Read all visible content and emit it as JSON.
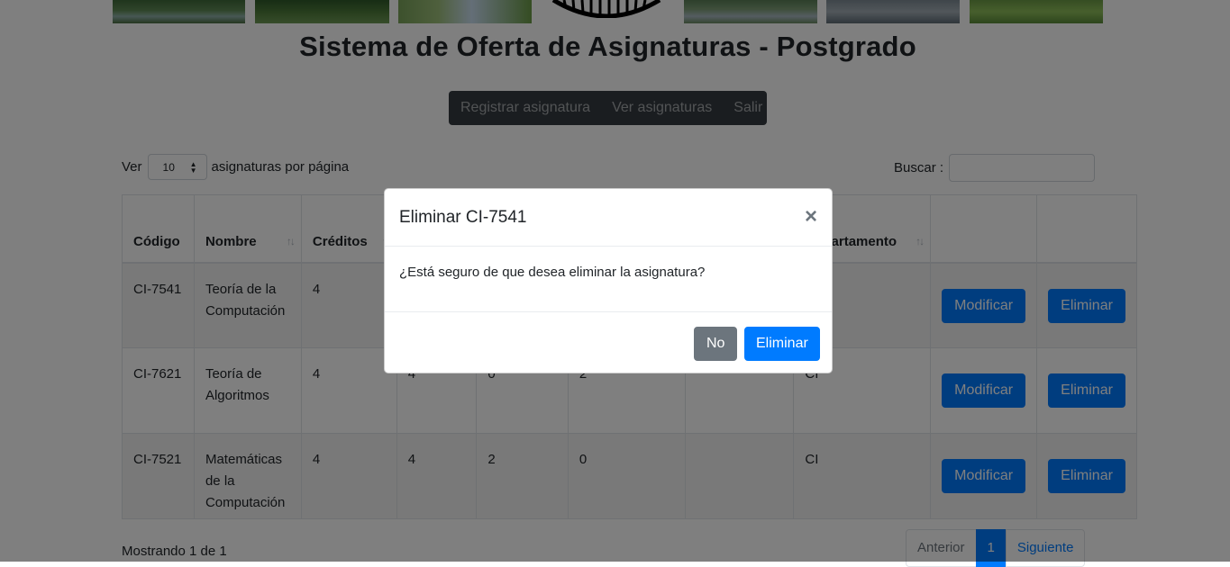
{
  "page": {
    "title": "Sistema de Oferta de Asignaturas - Postgrado"
  },
  "nav": {
    "items": [
      "Registrar asignatura",
      "Ver asignaturas",
      "Salir"
    ]
  },
  "controls": {
    "show_prefix": "Ver",
    "page_size": "10",
    "show_suffix": "asignaturas por página",
    "search_label": "Buscar :",
    "search_value": ""
  },
  "table": {
    "headers": [
      "Código",
      "Nombre",
      "Créditos",
      "",
      "",
      "",
      "",
      "partamento",
      "",
      ""
    ],
    "rows": [
      {
        "codigo": "CI-7541",
        "nombre": "Teoría de la Computación",
        "creditos": "4",
        "c4": "",
        "c5": "",
        "c6": "",
        "c7": "",
        "depto": "",
        "modificar": "Modificar",
        "eliminar": "Eliminar"
      },
      {
        "codigo": "CI-7621",
        "nombre": "Teoría de Algoritmos",
        "creditos": "4",
        "c4": "4",
        "c5": "0",
        "c6": "2",
        "c7": "",
        "depto": "CI",
        "modificar": "Modificar",
        "eliminar": "Eliminar"
      },
      {
        "codigo": "CI-7521",
        "nombre": "Matemáticas de la Computación",
        "creditos": "4",
        "c4": "4",
        "c5": "2",
        "c6": "0",
        "c7": "",
        "depto": "CI",
        "modificar": "Modificar",
        "eliminar": "Eliminar"
      }
    ]
  },
  "footer": {
    "showing": "Mostrando 1 de 1",
    "pager": {
      "prev": "Anterior",
      "current": "1",
      "next": "Siguiente"
    }
  },
  "modal": {
    "title": "Eliminar CI-7541",
    "close_glyph": "×",
    "message": "¿Está seguro de que desea eliminar la asignatura?",
    "no_label": "No",
    "confirm_label": "Eliminar"
  },
  "colors": {
    "primary": "#007bff",
    "secondary": "#6c757d",
    "navbar": "#343a40"
  }
}
